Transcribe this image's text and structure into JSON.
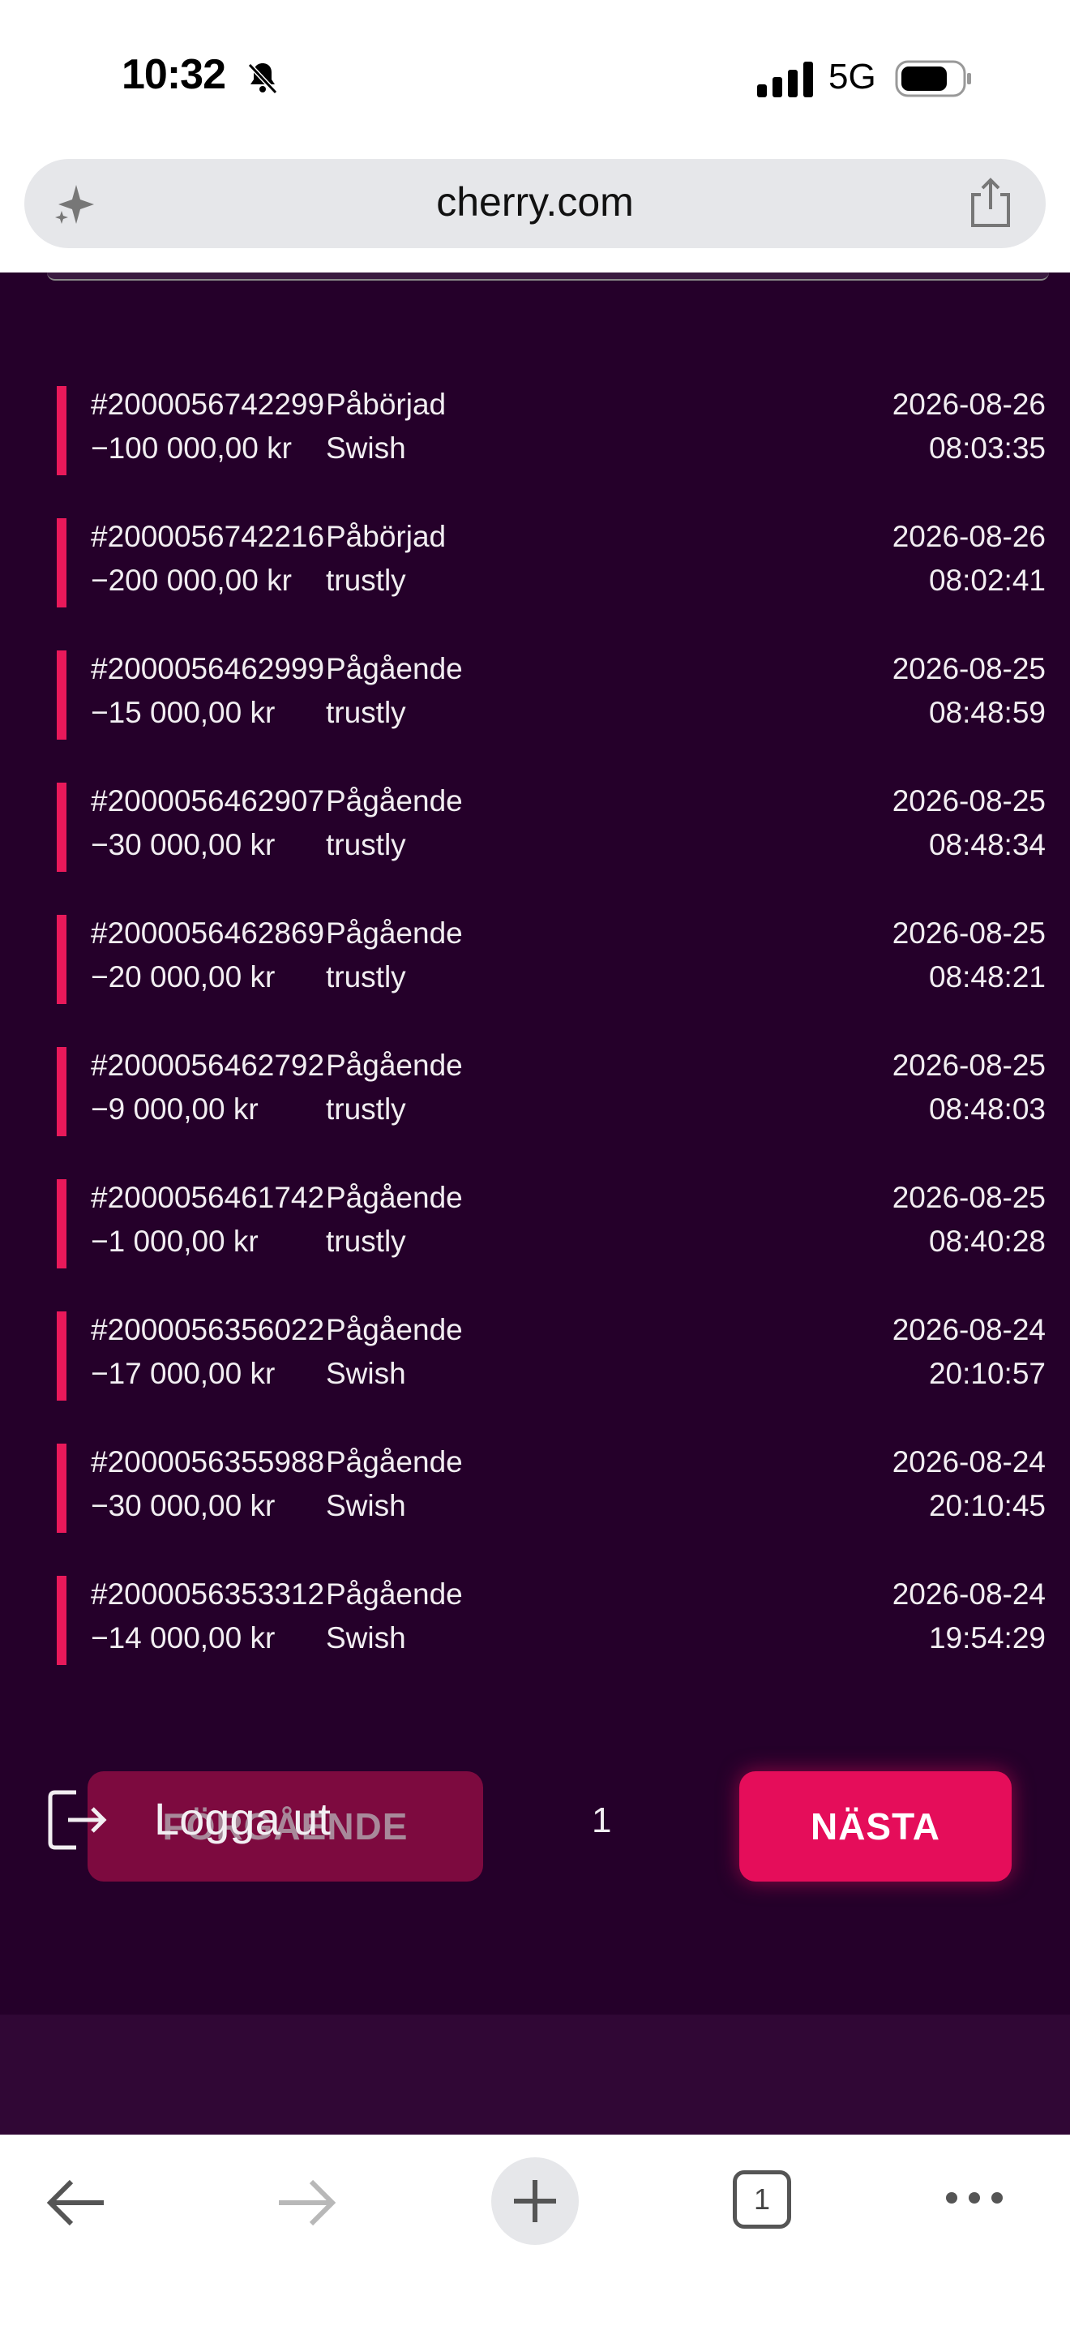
{
  "status_bar": {
    "time": "10:32",
    "network": "5G"
  },
  "browser": {
    "url": "cherry.com",
    "tab_count": "1"
  },
  "transactions": [
    {
      "id": "#2000056742299",
      "status": "Påbörjad",
      "amount": "−100 000,00 kr",
      "method": "Swish",
      "date": "2026-08-26",
      "time": "08:03:35"
    },
    {
      "id": "#2000056742216",
      "status": "Påbörjad",
      "amount": "−200 000,00 kr",
      "method": "trustly",
      "date": "2026-08-26",
      "time": "08:02:41"
    },
    {
      "id": "#2000056462999",
      "status": "Pågående",
      "amount": "−15 000,00 kr",
      "method": "trustly",
      "date": "2026-08-25",
      "time": "08:48:59"
    },
    {
      "id": "#2000056462907",
      "status": "Pågående",
      "amount": "−30 000,00 kr",
      "method": "trustly",
      "date": "2026-08-25",
      "time": "08:48:34"
    },
    {
      "id": "#2000056462869",
      "status": "Pågående",
      "amount": "−20 000,00 kr",
      "method": "trustly",
      "date": "2026-08-25",
      "time": "08:48:21"
    },
    {
      "id": "#2000056462792",
      "status": "Pågående",
      "amount": "−9 000,00 kr",
      "method": "trustly",
      "date": "2026-08-25",
      "time": "08:48:03"
    },
    {
      "id": "#2000056461742",
      "status": "Pågående",
      "amount": "−1 000,00 kr",
      "method": "trustly",
      "date": "2026-08-25",
      "time": "08:40:28"
    },
    {
      "id": "#2000056356022",
      "status": "Pågående",
      "amount": "−17 000,00 kr",
      "method": "Swish",
      "date": "2026-08-24",
      "time": "20:10:57"
    },
    {
      "id": "#2000056355988",
      "status": "Pågående",
      "amount": "−30 000,00 kr",
      "method": "Swish",
      "date": "2026-08-24",
      "time": "20:10:45"
    },
    {
      "id": "#2000056353312",
      "status": "Pågående",
      "amount": "−14 000,00 kr",
      "method": "Swish",
      "date": "2026-08-24",
      "time": "19:54:29"
    }
  ],
  "pagination": {
    "prev_label": "FÖRGÅENDE",
    "page": "1",
    "next_label": "NÄSTA"
  },
  "logout_label": "Logga ut",
  "colors": {
    "background": "#25002a",
    "accent": "#e8195a",
    "prev_button": "#7d0a3f",
    "next_button": "#e50d5a"
  }
}
